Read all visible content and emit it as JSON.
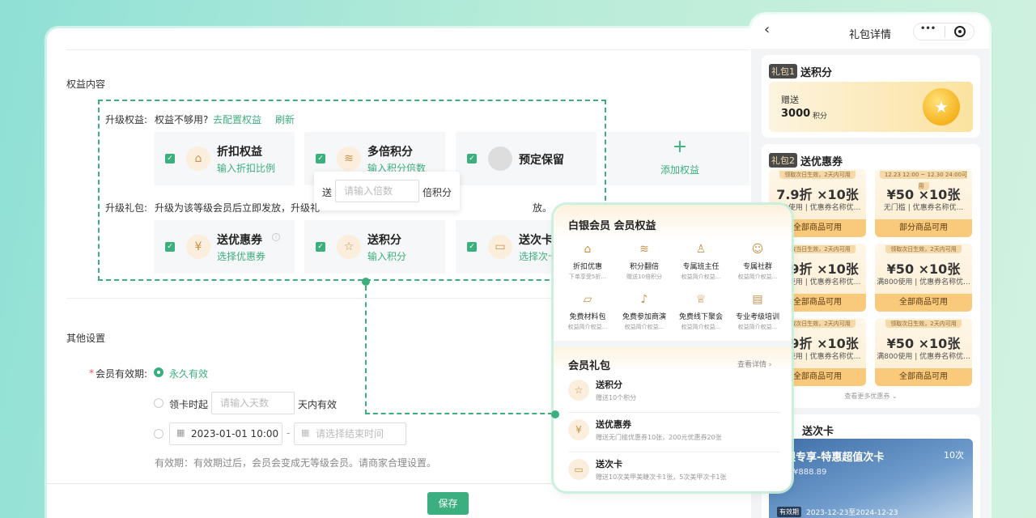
{
  "admin": {
    "section_rights": "权益内容",
    "upgrade_rights_label": "升级权益:",
    "not_enough": "权益不够用?",
    "configure_link": "去配置权益",
    "refresh_link": "刷新",
    "cards": [
      {
        "title": "折扣权益",
        "sub": "输入折扣比例",
        "icon": "tag-icon"
      },
      {
        "title": "多倍积分",
        "sub": "输入积分倍数",
        "icon": "coins-icon"
      },
      {
        "title": "预定保留",
        "sub": "",
        "icon": "gray-circle-icon"
      }
    ],
    "add_rights": "添加权益",
    "multiplier_popup": {
      "prefix": "送",
      "placeholder": "请输入倍数",
      "suffix": "倍积分"
    },
    "gift_label": "升级礼包:",
    "gift_desc_a": "升级为该等级会员后立即发放，升级礼",
    "gift_desc_b": "放。",
    "gift_cards": [
      {
        "title": "送优惠券",
        "sub": "选择优惠券",
        "icon": "coupon-icon"
      },
      {
        "title": "送积分",
        "sub": "输入积分",
        "icon": "star-icon"
      },
      {
        "title": "送次卡",
        "sub": "选择次卡",
        "icon": "card-icon"
      }
    ],
    "section_other": "其他设置",
    "validity_label": "会员有效期:",
    "opt_forever": "永久有效",
    "opt_from_card": "领卡时起",
    "days_placeholder": "请输入天数",
    "days_suffix": "天内有效",
    "start_date": "2023-01-01 10:00",
    "end_placeholder": "请选择结束时间",
    "range_sep": "-",
    "validity_note": "有效期：有效期过后，会员会变成无等级会员。请商家合理设置。",
    "save": "保存",
    "required_mark": "*"
  },
  "phone": {
    "title": "礼包详情",
    "back": "‹",
    "menu": "•••",
    "pack1": {
      "tag": "礼包1",
      "name": "送积分",
      "give": "赠送",
      "points": "3000",
      "unit": "积分"
    },
    "pack2": {
      "tag": "礼包2",
      "name": "送优惠券",
      "coupons": [
        {
          "head": "领取次日生效，2天内可用",
          "value": "7.9折 ×10张",
          "desc": "200使用 | 优惠券名称优...",
          "foot": "全部商品可用"
        },
        {
          "head": "12.23 12:00 ~ 12.30 24:00可用",
          "value": "¥50 ×10张",
          "desc": "无门槛 | 优惠券名称优...",
          "foot": "部分商品可用"
        },
        {
          "head": "领取当日生效，2天内可用",
          "value": "7.9折 ×10张",
          "desc": "200使用 | 优惠券名称优...",
          "foot": "全部商品可用"
        },
        {
          "head": "领取次日生效，2天内可用",
          "value": "¥50 ×10张",
          "desc": "满800使用 | 优惠券名称优...",
          "foot": "全部商品可用"
        },
        {
          "head": "领取次日生效，2天内可用",
          "value": "7.9折 ×10张",
          "desc": "200使用 | 优惠券名称优...",
          "foot": "全部商品可用"
        },
        {
          "head": "领取次日生效，2天内可用",
          "value": "¥50 ×10张",
          "desc": "满800使用 | 优惠券名称优...",
          "foot": "全部商品可用"
        }
      ],
      "more": "查看更多优惠券 ⌄"
    },
    "pack3": {
      "name": "送次卡",
      "card_title": "银专享-特惠超值次卡",
      "count": "10次",
      "price": "价¥888.89",
      "badge": "有效期",
      "period": "2023-12-23至2024-12-23"
    }
  },
  "overlay": {
    "title": "白银会员 会员权益",
    "benefits": [
      {
        "name": "折扣优惠",
        "desc": "下单享受5折..."
      },
      {
        "name": "积分翻倍",
        "desc": "赠送10倍积分"
      },
      {
        "name": "专属班主任",
        "desc": "权益简介权益..."
      },
      {
        "name": "专属社群",
        "desc": "权益简介权益..."
      },
      {
        "name": "免费材料包",
        "desc": "权益简介权益..."
      },
      {
        "name": "免费参加商演",
        "desc": "权益简介权益..."
      },
      {
        "name": "免费线下聚会",
        "desc": "权益简介权益..."
      },
      {
        "name": "专业考级培训",
        "desc": "权益简介权益..."
      }
    ],
    "gift_title": "会员礼包",
    "view_detail": "查看详情 ›",
    "gifts": [
      {
        "title": "送积分",
        "desc": "赠送10个积分"
      },
      {
        "title": "送优惠券",
        "desc": "赠送无门槛优惠券10张，200元优惠券20张"
      },
      {
        "title": "送次卡",
        "desc": "赠送10次美甲美睫次卡1张，5次美甲次卡1张"
      }
    ]
  }
}
